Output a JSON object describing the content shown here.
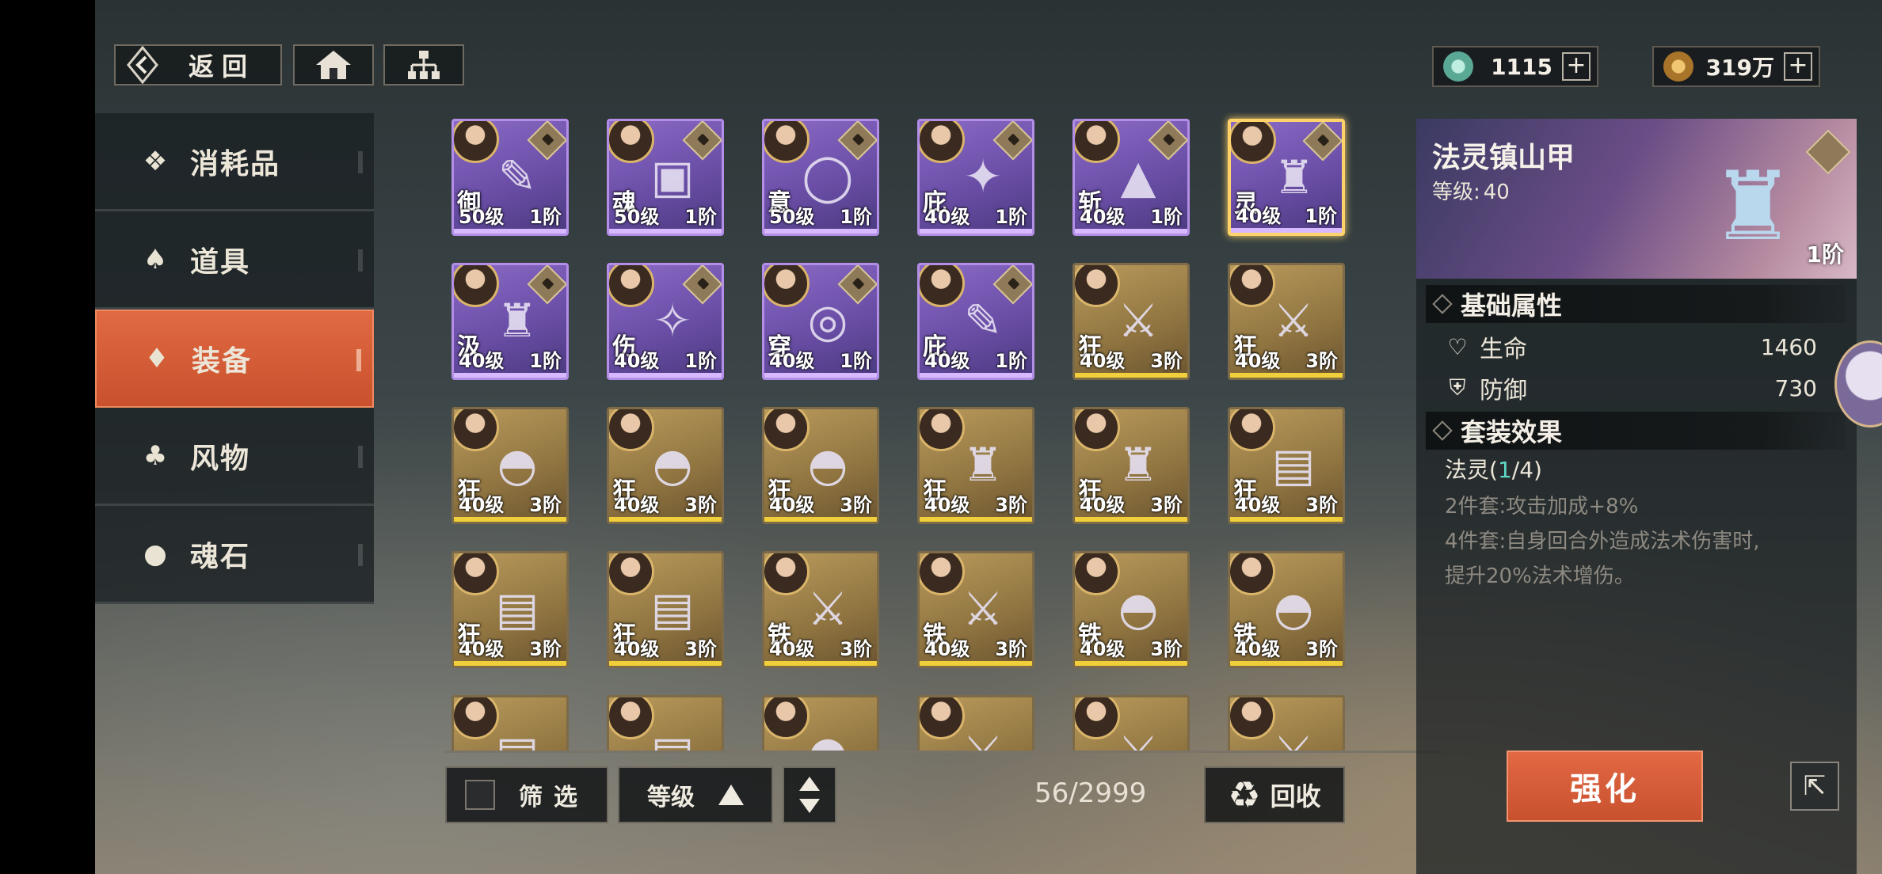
{
  "nav": {
    "back_label": "返回",
    "back_icon": "back-arrow-icon",
    "home_icon": "home-icon",
    "tree_icon": "hierarchy-icon"
  },
  "currencies": [
    {
      "icon": "jade-icon",
      "value": "1115",
      "plus": "+",
      "color": "#7fd0c0"
    },
    {
      "icon": "coin-icon",
      "value": "319万",
      "plus": "+",
      "color": "#d4a048"
    }
  ],
  "categories": [
    {
      "label": "消耗品",
      "icon": "consumable-icon",
      "glyph": "❖",
      "active": false
    },
    {
      "label": "道具",
      "icon": "item-bag-icon",
      "glyph": "♠",
      "active": false
    },
    {
      "label": "装备",
      "icon": "armor-icon",
      "glyph": "♦",
      "active": true
    },
    {
      "label": "风物",
      "icon": "scenery-icon",
      "glyph": "♣",
      "active": false
    },
    {
      "label": "魂石",
      "icon": "soulstone-icon",
      "glyph": "●",
      "active": false
    }
  ],
  "grid_items": [
    {
      "tag": "御",
      "level": "50级",
      "stars": "1阶",
      "rarity": "purple",
      "art": "✎",
      "locked": true,
      "selected": false
    },
    {
      "tag": "魂",
      "level": "50级",
      "stars": "1阶",
      "rarity": "purple",
      "art": "▣",
      "locked": true,
      "selected": false
    },
    {
      "tag": "意",
      "level": "50级",
      "stars": "1阶",
      "rarity": "purple",
      "art": "◯",
      "locked": true,
      "selected": false
    },
    {
      "tag": "庇",
      "level": "40级",
      "stars": "1阶",
      "rarity": "purple",
      "art": "✦",
      "locked": true,
      "selected": false
    },
    {
      "tag": "斩",
      "level": "40级",
      "stars": "1阶",
      "rarity": "purple",
      "art": "▲",
      "locked": true,
      "selected": false
    },
    {
      "tag": "灵",
      "level": "40级",
      "stars": "1阶",
      "rarity": "purple",
      "art": "♜",
      "locked": true,
      "selected": true
    },
    {
      "tag": "汲",
      "level": "40级",
      "stars": "1阶",
      "rarity": "purple",
      "art": "♜",
      "locked": true,
      "selected": false
    },
    {
      "tag": "伤",
      "level": "40级",
      "stars": "1阶",
      "rarity": "purple",
      "art": "✧",
      "locked": true,
      "selected": false
    },
    {
      "tag": "穿",
      "level": "40级",
      "stars": "1阶",
      "rarity": "purple",
      "art": "◎",
      "locked": true,
      "selected": false
    },
    {
      "tag": "庇",
      "level": "40级",
      "stars": "1阶",
      "rarity": "purple",
      "art": "✎",
      "locked": true,
      "selected": false
    },
    {
      "tag": "狂",
      "level": "40级",
      "stars": "3阶",
      "rarity": "gold",
      "art": "⚔",
      "locked": false,
      "selected": false
    },
    {
      "tag": "狂",
      "level": "40级",
      "stars": "3阶",
      "rarity": "gold",
      "art": "⚔",
      "locked": false,
      "selected": false
    },
    {
      "tag": "狂",
      "level": "40级",
      "stars": "3阶",
      "rarity": "gold",
      "art": "◓",
      "locked": false,
      "selected": false
    },
    {
      "tag": "狂",
      "level": "40级",
      "stars": "3阶",
      "rarity": "gold",
      "art": "◓",
      "locked": false,
      "selected": false
    },
    {
      "tag": "狂",
      "level": "40级",
      "stars": "3阶",
      "rarity": "gold",
      "art": "◓",
      "locked": false,
      "selected": false
    },
    {
      "tag": "狂",
      "level": "40级",
      "stars": "3阶",
      "rarity": "gold",
      "art": "♜",
      "locked": false,
      "selected": false
    },
    {
      "tag": "狂",
      "level": "40级",
      "stars": "3阶",
      "rarity": "gold",
      "art": "♜",
      "locked": false,
      "selected": false
    },
    {
      "tag": "狂",
      "level": "40级",
      "stars": "3阶",
      "rarity": "gold",
      "art": "▤",
      "locked": false,
      "selected": false
    },
    {
      "tag": "狂",
      "level": "40级",
      "stars": "3阶",
      "rarity": "gold",
      "art": "▤",
      "locked": false,
      "selected": false
    },
    {
      "tag": "狂",
      "level": "40级",
      "stars": "3阶",
      "rarity": "gold",
      "art": "▤",
      "locked": false,
      "selected": false
    },
    {
      "tag": "铁",
      "level": "40级",
      "stars": "3阶",
      "rarity": "gold",
      "art": "⚔",
      "locked": false,
      "selected": false
    },
    {
      "tag": "铁",
      "level": "40级",
      "stars": "3阶",
      "rarity": "gold",
      "art": "⚔",
      "locked": false,
      "selected": false
    },
    {
      "tag": "铁",
      "level": "40级",
      "stars": "3阶",
      "rarity": "gold",
      "art": "◓",
      "locked": false,
      "selected": false
    },
    {
      "tag": "铁",
      "level": "40级",
      "stars": "3阶",
      "rarity": "gold",
      "art": "◓",
      "locked": false,
      "selected": false
    },
    {
      "tag": "",
      "level": "",
      "stars": "",
      "rarity": "gold",
      "art": "▤",
      "locked": false,
      "selected": false
    },
    {
      "tag": "",
      "level": "",
      "stars": "",
      "rarity": "gold",
      "art": "▤",
      "locked": false,
      "selected": false
    },
    {
      "tag": "",
      "level": "",
      "stars": "",
      "rarity": "gold",
      "art": "◓",
      "locked": false,
      "selected": false
    },
    {
      "tag": "",
      "level": "",
      "stars": "",
      "rarity": "gold",
      "art": "⚔",
      "locked": false,
      "selected": false
    },
    {
      "tag": "",
      "level": "",
      "stars": "",
      "rarity": "gold",
      "art": "⚔",
      "locked": false,
      "selected": false
    },
    {
      "tag": "",
      "level": "",
      "stars": "",
      "rarity": "gold",
      "art": "⚔",
      "locked": false,
      "selected": false
    }
  ],
  "bottom": {
    "filter_label": "筛选",
    "sort_label": "等级",
    "sort_direction": "ascending",
    "count": "56/2999",
    "recycle_label": "回收",
    "recycle_icon": "recycle-icon"
  },
  "detail": {
    "name": "法灵镇山甲",
    "level_label": "等级:",
    "level_value": "40",
    "stars": "1阶",
    "locked": true,
    "base_title": "基础属性",
    "stats": [
      {
        "label": "生命",
        "value": "1460",
        "icon": "heart-icon"
      },
      {
        "label": "防御",
        "value": "730",
        "icon": "shield-icon"
      }
    ],
    "set_title": "套装效果",
    "set_name": "法灵",
    "set_count_open": "(",
    "set_count_have": "1",
    "set_count_rest": "/4)",
    "set_bonus_2": "2件套:攻击加成+8%",
    "set_bonus_4_line1": "4件套:自身回合外造成法术伤害时,",
    "set_bonus_4_line2": "提升20%法术增伤。",
    "enhance_label": "强化",
    "share_icon": "expand-icon"
  },
  "colors": {
    "accent_orange": "#d65a34",
    "purple_rarity": "#7a5cb8",
    "gold_rarity": "#a88a50",
    "cyan_text": "#5fd9c6"
  }
}
